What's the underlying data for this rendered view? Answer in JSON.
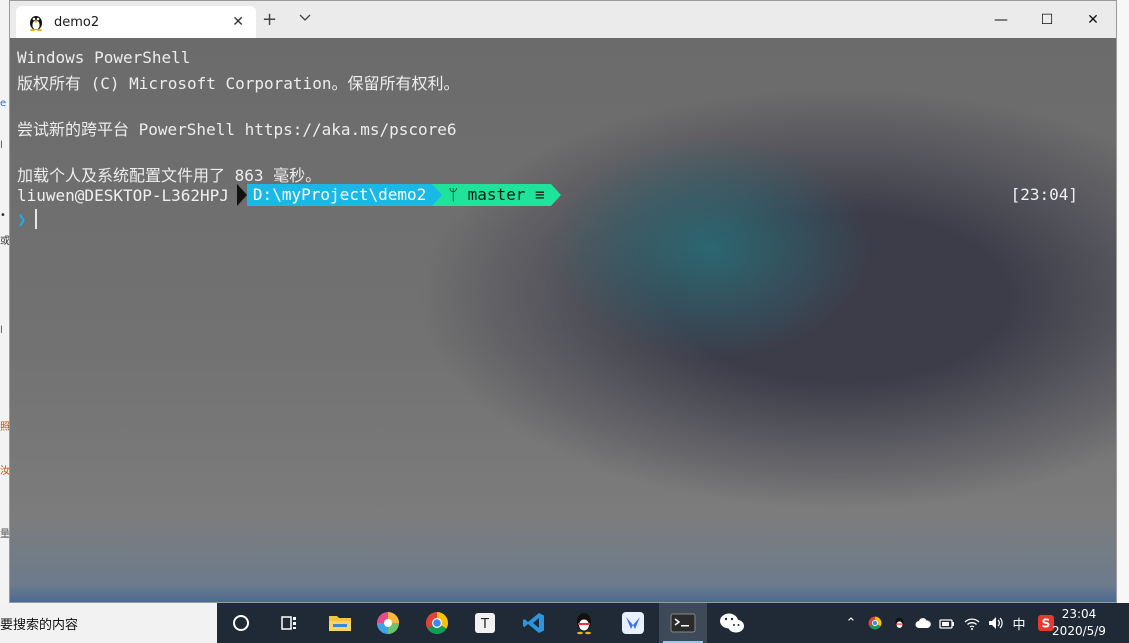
{
  "window": {
    "tab_title": "demo2",
    "new_tab_symbol": "+",
    "close_tab_symbol": "✕",
    "controls": {
      "minimize": "—",
      "maximize": "☐",
      "close": "✕"
    }
  },
  "terminal": {
    "lines": [
      "Windows PowerShell",
      "版权所有 (C) Microsoft Corporation。保留所有权利。",
      "",
      "尝试新的跨平台 PowerShell https://aka.ms/pscore6",
      "",
      "加载个人及系统配置文件用了 863 毫秒。"
    ],
    "prompt": {
      "user_host": "liuwen@DESKTOP-L362HPJ",
      "path": "D:\\myProject\\demo2",
      "git_branch_icon": "ᛘ",
      "git_branch": "master",
      "git_status": "≡",
      "time": "[23:04]",
      "caret": "❯"
    },
    "colors": {
      "path_bg": "#19b8e6",
      "git_bg": "#1fe39a",
      "caret": "#21a8e8"
    }
  },
  "taskbar": {
    "search_placeholder": "要搜索的内容",
    "apps": [
      "cortana-icon",
      "task-view-icon",
      "file-explorer-icon",
      "photos-icon",
      "chrome-icon",
      "typora-icon",
      "vscode-icon",
      "qq-icon",
      "feishu-icon",
      "terminal-icon",
      "wechat-icon"
    ],
    "tray": {
      "chevron": "⌃",
      "ime": "中",
      "time": "23:04",
      "date": "2020/5/9"
    }
  }
}
